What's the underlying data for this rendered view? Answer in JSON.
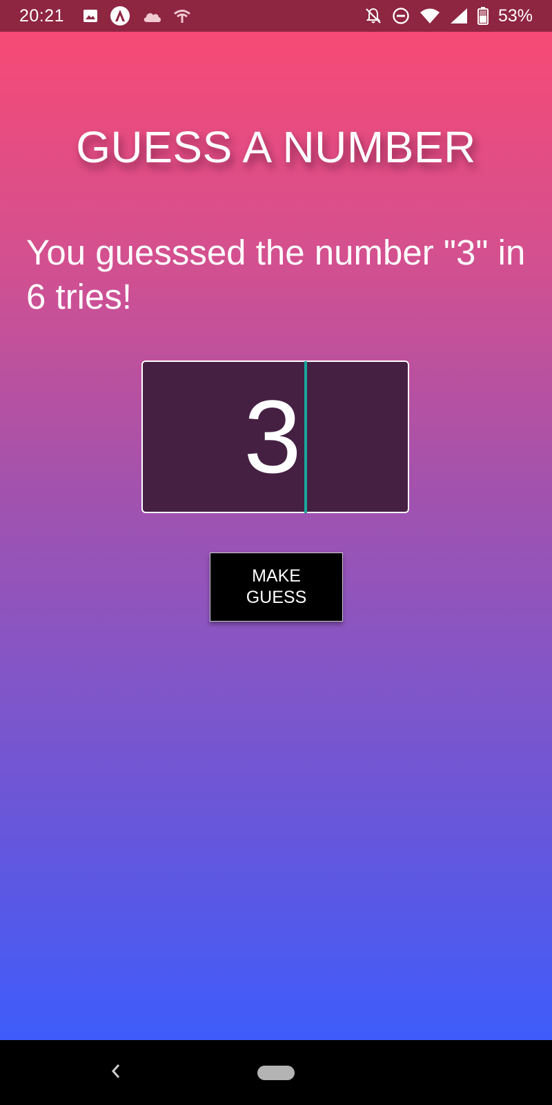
{
  "status_bar": {
    "time": "20:21",
    "battery_percent": "53%",
    "background_color": "#8e2541",
    "left_icons": [
      "image-icon",
      "app-logo-icon",
      "cloud-icon",
      "wifi-signal-icon"
    ],
    "right_icons": [
      "notifications-off-icon",
      "do-not-disturb-icon",
      "wifi-icon",
      "cell-signal-icon",
      "battery-icon"
    ]
  },
  "header": {
    "title": "GUESS A NUMBER"
  },
  "result": {
    "message": "You guesssed the number \"3\" in 6 tries!"
  },
  "guess_input": {
    "value": "3"
  },
  "actions": {
    "make_guess_label": "MAKE GUESS"
  },
  "nav_bar": {
    "icons": [
      "back-icon",
      "home-pill-icon"
    ]
  },
  "colors": {
    "gradient_top": "#f64a75",
    "gradient_bottom": "#3e5cfb",
    "input_background": "#452043",
    "caret": "#1aa79b",
    "button_background": "#000000"
  }
}
